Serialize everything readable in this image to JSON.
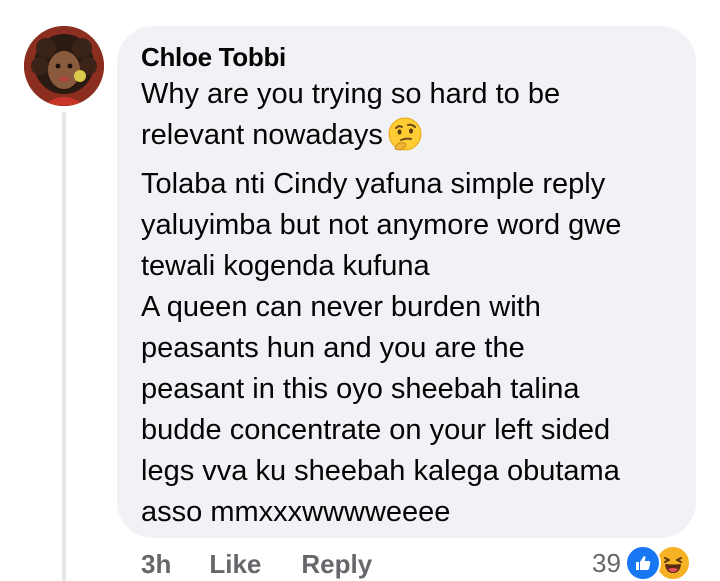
{
  "comment": {
    "author": "Chloe Tobbi",
    "lines": [
      "Why are you trying so hard to be",
      "relevant nowadays",
      "Tolaba nti Cindy yafuna simple reply",
      "yaluyimba but not anymore word gwe",
      "tewali kogenda kufuna",
      "A queen can never burden with",
      "peasants hun and you are the",
      "peasant in this oyo sheebah talina",
      "budde concentrate on your left sided",
      "legs vva ku sheebah kalega obutama",
      "asso mmxxxwwwweeee"
    ],
    "inline_emoji": "thinking-face-icon"
  },
  "actions": {
    "time": "3h",
    "like_label": "Like",
    "reply_label": "Reply"
  },
  "reactions": {
    "count": "39",
    "icons": [
      "like-reaction-icon",
      "haha-reaction-icon"
    ]
  },
  "colors": {
    "bubble_bg": "#f0f2f5",
    "text": "#050505",
    "meta_text": "#65676b",
    "like_blue": "#1877f2",
    "haha_yellow": "#f7b125"
  }
}
